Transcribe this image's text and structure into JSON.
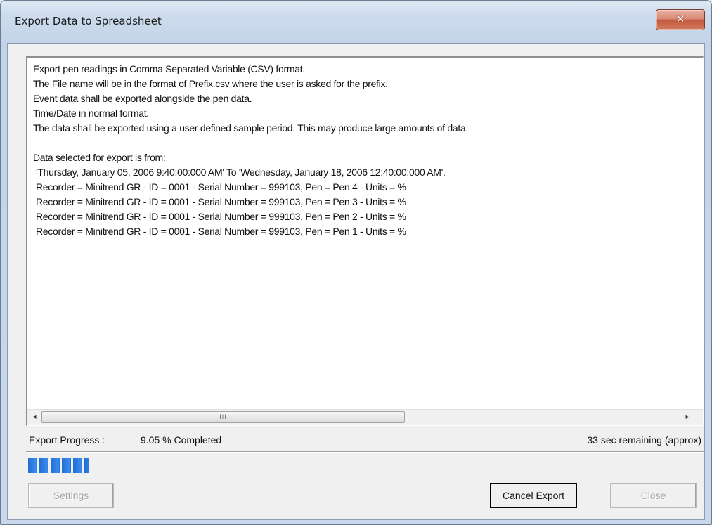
{
  "window": {
    "title": "Export Data to Spreadsheet",
    "close_glyph": "✕"
  },
  "log": {
    "lines": [
      "Export pen readings in Comma Separated Variable (CSV) format.",
      "The File name will be in the format of Prefix.csv where the user is asked for the prefix.",
      "Event data shall be exported alongside the pen data.",
      "Time/Date in normal format.",
      "The data shall be exported using a user defined sample period. This may produce large amounts of data.",
      "",
      "Data selected for export is from:",
      " 'Thursday, January 05, 2006 9:40:00:000 AM' To 'Wednesday, January 18, 2006 12:40:00:000 AM'.",
      " Recorder = Minitrend GR - ID = 0001 - Serial Number = 999103, Pen =  Pen 4 - Units = %",
      " Recorder = Minitrend GR - ID = 0001 - Serial Number = 999103, Pen =  Pen 3 - Units = %",
      " Recorder = Minitrend GR - ID = 0001 - Serial Number = 999103, Pen =  Pen 2 - Units = %",
      " Recorder = Minitrend GR - ID = 0001 - Serial Number = 999103, Pen =  Pen 1 - Units = %"
    ],
    "scroll_grip": "III",
    "scroll_left_glyph": "◂",
    "scroll_right_glyph": "▸"
  },
  "progress": {
    "label": "Export Progress :",
    "percent_text": "9.05 % Completed",
    "remaining_text": "33 sec remaining (approx)",
    "fraction": 0.0905,
    "fill_color": "#2f7fe6"
  },
  "buttons": {
    "settings": "Settings",
    "cancel_export": "Cancel Export",
    "close": "Close"
  },
  "icons": {
    "title_close": "close-icon",
    "scroll_left": "arrow-left-icon",
    "scroll_right": "arrow-right-icon"
  }
}
